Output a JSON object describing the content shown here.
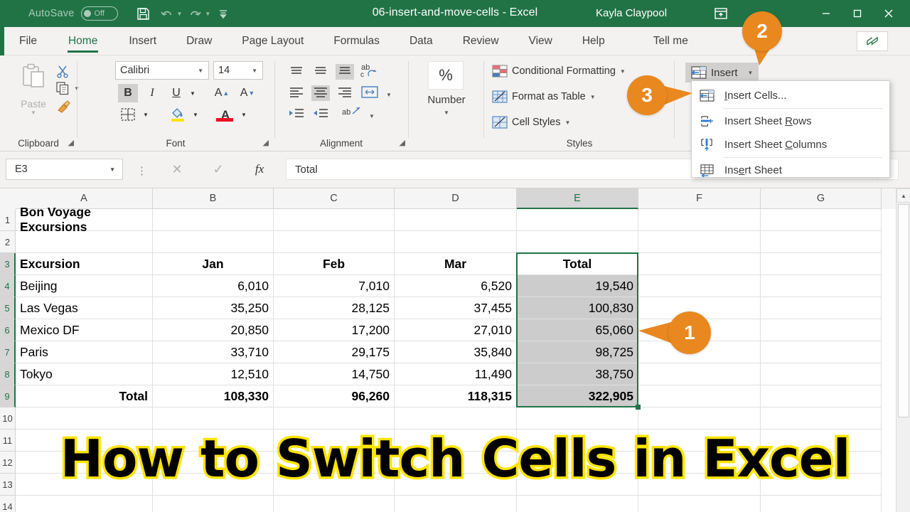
{
  "titlebar": {
    "autosave_label": "AutoSave",
    "autosave_state": "Off",
    "save_icon": "save-icon",
    "undo_icon": "undo-icon",
    "redo_icon": "redo-icon",
    "customize_icon": "customize-quick-access-icon",
    "document_title": "06-insert-and-move-cells  -  Excel",
    "user_name": "Kayla Claypool",
    "ribbon_display_icon": "ribbon-display-options-icon",
    "minimize_label": "—",
    "maximize_label": "☐",
    "close_label": "✕",
    "accent_color": "#217346"
  },
  "tabs": [
    {
      "label": "File",
      "active": false
    },
    {
      "label": "Home",
      "active": true
    },
    {
      "label": "Insert",
      "active": false
    },
    {
      "label": "Draw",
      "active": false
    },
    {
      "label": "Page Layout",
      "active": false
    },
    {
      "label": "Formulas",
      "active": false
    },
    {
      "label": "Data",
      "active": false
    },
    {
      "label": "Review",
      "active": false
    },
    {
      "label": "View",
      "active": false
    },
    {
      "label": "Help",
      "active": false
    },
    {
      "label": "Tell me",
      "active": false
    }
  ],
  "share_button": {
    "icon": "share-icon"
  },
  "ribbon": {
    "clipboard": {
      "group_label": "Clipboard",
      "paste_label": "Paste",
      "cut_icon": "scissors-icon",
      "copy_icon": "copy-icon",
      "format_painter_icon": "format-painter-icon"
    },
    "font": {
      "group_label": "Font",
      "font_family": "Calibri",
      "font_size": "14",
      "bold_label": "B",
      "italic_label": "I",
      "underline_label": "U",
      "grow_font_label": "A",
      "shrink_font_label": "A",
      "borders_icon": "borders-icon",
      "fill_color_icon": "fill-color-icon",
      "font_color_label": "A"
    },
    "alignment": {
      "group_label": "Alignment",
      "top_align_icon": "align-top-icon",
      "middle_align_icon": "align-middle-icon",
      "bottom_align_icon": "align-bottom-icon",
      "orientation_icon": "orientation-icon",
      "align_left_icon": "align-left-icon",
      "align_center_icon": "align-center-icon",
      "align_right_icon": "align-right-icon",
      "wrap_text_icon": "wrap-text-icon",
      "decrease_indent_icon": "decrease-indent-icon",
      "increase_indent_icon": "increase-indent-icon",
      "merge_icon": "merge-and-center-icon"
    },
    "number": {
      "group_label": "Number",
      "percent_label": "%"
    },
    "styles": {
      "group_label": "Styles",
      "items": [
        {
          "label": "Conditional Formatting",
          "icon": "conditional-formatting-icon"
        },
        {
          "label": "Format as Table",
          "icon": "format-as-table-icon"
        },
        {
          "label": "Cell Styles",
          "icon": "cell-styles-icon"
        }
      ]
    },
    "cells": {
      "insert_label": "Insert",
      "insert_icon": "insert-cells-icon"
    },
    "search": {
      "icon": "search-icon"
    }
  },
  "insert_menu": {
    "items": [
      {
        "pre": "",
        "key": "I",
        "post": "nsert Cells...",
        "icon": "insert-cells-icon"
      },
      {
        "pre": "Insert Sheet ",
        "key": "R",
        "post": "ows",
        "icon": "insert-sheet-rows-icon"
      },
      {
        "pre": "Insert Sheet ",
        "key": "C",
        "post": "olumns",
        "icon": "insert-sheet-columns-icon"
      },
      {
        "pre": "Ins",
        "key": "e",
        "post": "rt Sheet",
        "icon": "insert-sheet-icon"
      }
    ]
  },
  "formula_bar": {
    "name_box_value": "E3",
    "cancel_icon": "cancel-icon",
    "enter_icon": "enter-icon",
    "fx_label": "fx",
    "formula_value": "Total",
    "expand_icon": "expand-formula-bar-icon"
  },
  "grid": {
    "columns": [
      "A",
      "B",
      "C",
      "D",
      "E",
      "F",
      "G"
    ],
    "selected_column": "E",
    "rows": [
      1,
      2,
      3,
      4,
      5,
      6,
      7,
      8,
      9,
      10,
      11,
      12,
      13,
      14
    ],
    "selected_rows": [
      3,
      4,
      5,
      6,
      7,
      8,
      9
    ],
    "cells": [
      {
        "row": 1,
        "col": "A",
        "value": "Bon Voyage Excursions",
        "align": "left",
        "bold": true,
        "shaded": false
      },
      {
        "row": 3,
        "col": "A",
        "value": "Excursion",
        "align": "left",
        "bold": true,
        "shaded": false
      },
      {
        "row": 3,
        "col": "B",
        "value": "Jan",
        "align": "center",
        "bold": true,
        "shaded": false
      },
      {
        "row": 3,
        "col": "C",
        "value": "Feb",
        "align": "center",
        "bold": true,
        "shaded": false
      },
      {
        "row": 3,
        "col": "D",
        "value": "Mar",
        "align": "center",
        "bold": true,
        "shaded": false
      },
      {
        "row": 3,
        "col": "E",
        "value": "Total",
        "align": "center",
        "bold": true,
        "shaded": false
      },
      {
        "row": 4,
        "col": "A",
        "value": "Beijing",
        "align": "left",
        "bold": false,
        "shaded": false
      },
      {
        "row": 4,
        "col": "B",
        "value": "6,010",
        "align": "right",
        "bold": false,
        "shaded": false
      },
      {
        "row": 4,
        "col": "C",
        "value": "7,010",
        "align": "right",
        "bold": false,
        "shaded": false
      },
      {
        "row": 4,
        "col": "D",
        "value": "6,520",
        "align": "right",
        "bold": false,
        "shaded": false
      },
      {
        "row": 4,
        "col": "E",
        "value": "19,540",
        "align": "right",
        "bold": false,
        "shaded": true
      },
      {
        "row": 5,
        "col": "A",
        "value": "Las Vegas",
        "align": "left",
        "bold": false,
        "shaded": false
      },
      {
        "row": 5,
        "col": "B",
        "value": "35,250",
        "align": "right",
        "bold": false,
        "shaded": false
      },
      {
        "row": 5,
        "col": "C",
        "value": "28,125",
        "align": "right",
        "bold": false,
        "shaded": false
      },
      {
        "row": 5,
        "col": "D",
        "value": "37,455",
        "align": "right",
        "bold": false,
        "shaded": false
      },
      {
        "row": 5,
        "col": "E",
        "value": "100,830",
        "align": "right",
        "bold": false,
        "shaded": true
      },
      {
        "row": 6,
        "col": "A",
        "value": "Mexico DF",
        "align": "left",
        "bold": false,
        "shaded": false
      },
      {
        "row": 6,
        "col": "B",
        "value": "20,850",
        "align": "right",
        "bold": false,
        "shaded": false
      },
      {
        "row": 6,
        "col": "C",
        "value": "17,200",
        "align": "right",
        "bold": false,
        "shaded": false
      },
      {
        "row": 6,
        "col": "D",
        "value": "27,010",
        "align": "right",
        "bold": false,
        "shaded": false
      },
      {
        "row": 6,
        "col": "E",
        "value": "65,060",
        "align": "right",
        "bold": false,
        "shaded": true
      },
      {
        "row": 7,
        "col": "A",
        "value": "Paris",
        "align": "left",
        "bold": false,
        "shaded": false
      },
      {
        "row": 7,
        "col": "B",
        "value": "33,710",
        "align": "right",
        "bold": false,
        "shaded": false
      },
      {
        "row": 7,
        "col": "C",
        "value": "29,175",
        "align": "right",
        "bold": false,
        "shaded": false
      },
      {
        "row": 7,
        "col": "D",
        "value": "35,840",
        "align": "right",
        "bold": false,
        "shaded": false
      },
      {
        "row": 7,
        "col": "E",
        "value": "98,725",
        "align": "right",
        "bold": false,
        "shaded": true
      },
      {
        "row": 8,
        "col": "A",
        "value": "Tokyo",
        "align": "left",
        "bold": false,
        "shaded": false
      },
      {
        "row": 8,
        "col": "B",
        "value": "12,510",
        "align": "right",
        "bold": false,
        "shaded": false
      },
      {
        "row": 8,
        "col": "C",
        "value": "14,750",
        "align": "right",
        "bold": false,
        "shaded": false
      },
      {
        "row": 8,
        "col": "D",
        "value": "11,490",
        "align": "right",
        "bold": false,
        "shaded": false
      },
      {
        "row": 8,
        "col": "E",
        "value": "38,750",
        "align": "right",
        "bold": false,
        "shaded": true
      },
      {
        "row": 9,
        "col": "A",
        "value": "Total",
        "align": "right",
        "bold": true,
        "shaded": false
      },
      {
        "row": 9,
        "col": "B",
        "value": "108,330",
        "align": "right",
        "bold": true,
        "shaded": false
      },
      {
        "row": 9,
        "col": "C",
        "value": "96,260",
        "align": "right",
        "bold": true,
        "shaded": false
      },
      {
        "row": 9,
        "col": "D",
        "value": "118,315",
        "align": "right",
        "bold": true,
        "shaded": false
      },
      {
        "row": 9,
        "col": "E",
        "value": "322,905",
        "align": "right",
        "bold": true,
        "shaded": true
      }
    ],
    "selection_range": "E3:E9"
  },
  "caption": {
    "text": "How to Switch Cells in Excel",
    "fill_color": "#000000",
    "outline_color": "#ffe400"
  },
  "callouts": [
    {
      "number": "1",
      "target": "selected-total-column"
    },
    {
      "number": "2",
      "target": "insert-dropdown-arrow"
    },
    {
      "number": "3",
      "target": "insert-cells-menu-item"
    }
  ]
}
